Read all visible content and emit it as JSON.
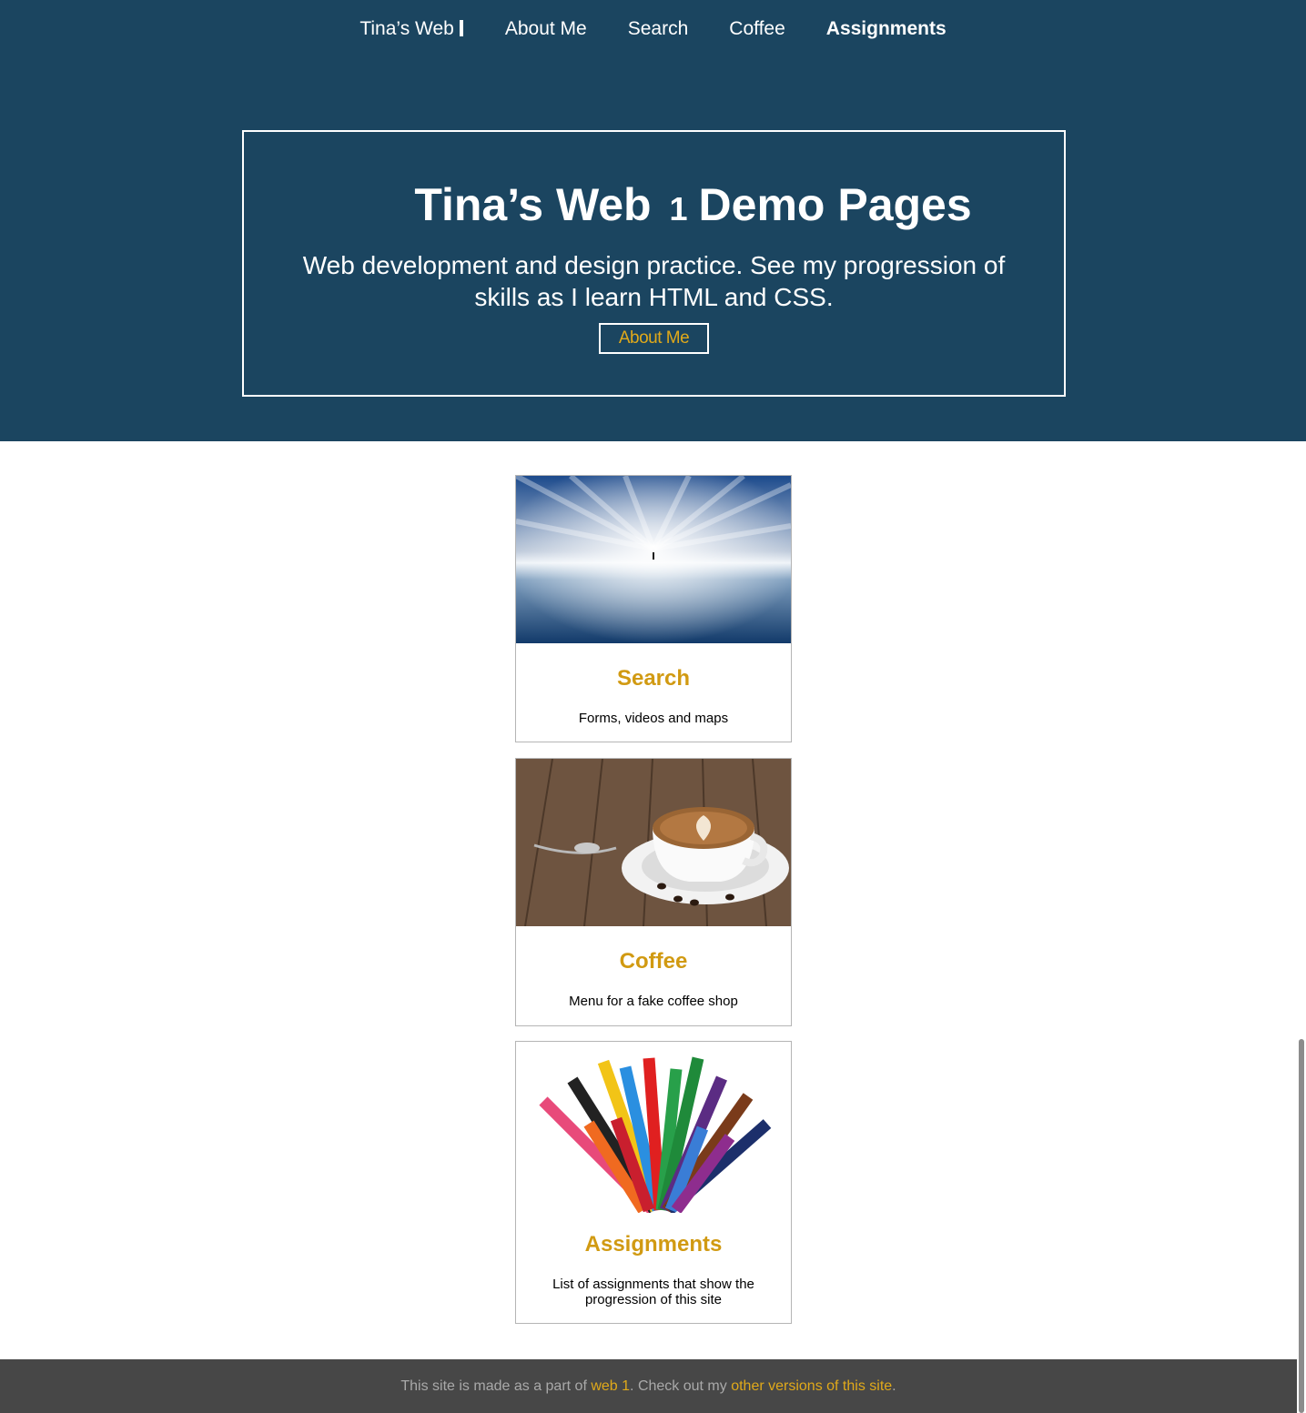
{
  "nav": {
    "brand": "Tina’s Web",
    "items": [
      {
        "label": "About Me"
      },
      {
        "label": "Search"
      },
      {
        "label": "Coffee"
      },
      {
        "label": "Assignments"
      }
    ]
  },
  "hero": {
    "title_pre": "Tina’s Web",
    "title_num": "1",
    "title_post": "Demo Pages",
    "subtitle": "Web development and design practice. See my progression of skills as I learn  HTML  and CSS.",
    "button": "About Me"
  },
  "cards": [
    {
      "title": "Search",
      "desc": "Forms, videos and maps"
    },
    {
      "title": "Coffee",
      "desc": "Menu for a fake coffee shop"
    },
    {
      "title": "Assignments",
      "desc": "List of assignments that show the progression of this site"
    }
  ],
  "footer": {
    "text1": "This site is made as a part of ",
    "link1": "web 1",
    "text2": ". Check out my ",
    "link2": "other versions of this site",
    "text3": "."
  },
  "colors": {
    "header_bg": "#1b4560",
    "accent": "#d19a12",
    "footer_bg": "#474747"
  }
}
